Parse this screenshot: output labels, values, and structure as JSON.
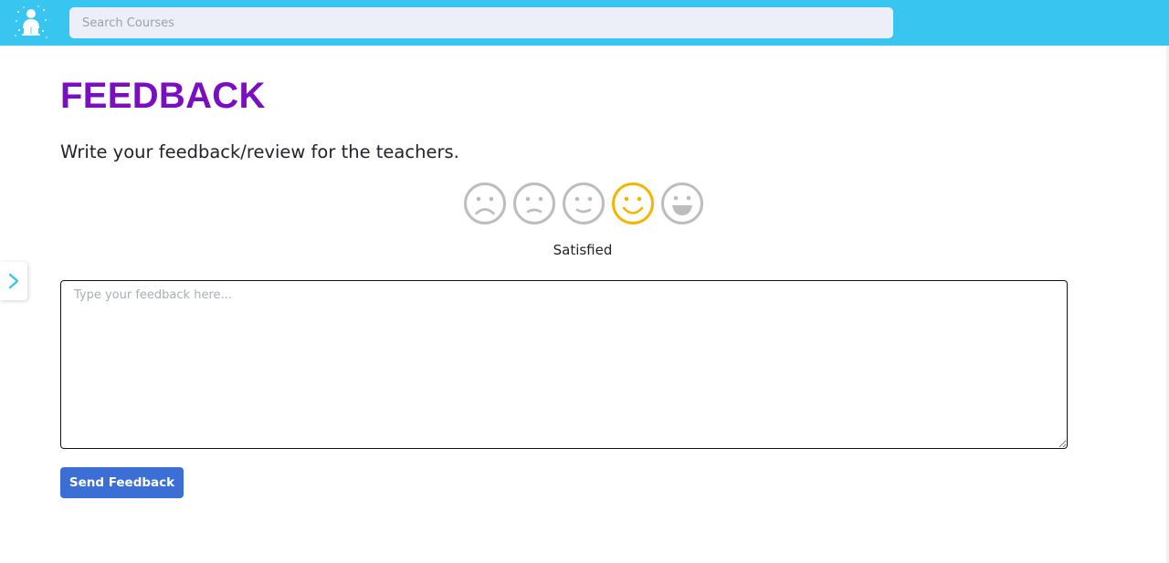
{
  "header": {
    "logo_icon": "student-reading-icon",
    "search": {
      "placeholder": "Search Courses",
      "value": ""
    },
    "background": "#38c5f0"
  },
  "sidebar_toggle": {
    "icon": "chevron-right-icon",
    "color": "#38c5f0"
  },
  "feedback": {
    "title": "FEEDBACK",
    "title_color": "#7a0fc2",
    "subtitle": "Write your feedback/review for the teachers.",
    "rating": {
      "options": [
        {
          "icon": "sad-face-icon"
        },
        {
          "icon": "slightly-sad-face-icon"
        },
        {
          "icon": "neutral-face-icon"
        },
        {
          "icon": "smiling-face-icon"
        },
        {
          "icon": "grinning-face-icon"
        }
      ],
      "selected_index": 3,
      "selected_label": "Satisfied",
      "active_color": "#f2b705",
      "inactive_color": "#bdbdbd"
    },
    "textarea": {
      "placeholder": "Type your feedback here...",
      "value": ""
    },
    "submit_label": "Send Feedback",
    "submit_color": "#3b6fd6"
  }
}
